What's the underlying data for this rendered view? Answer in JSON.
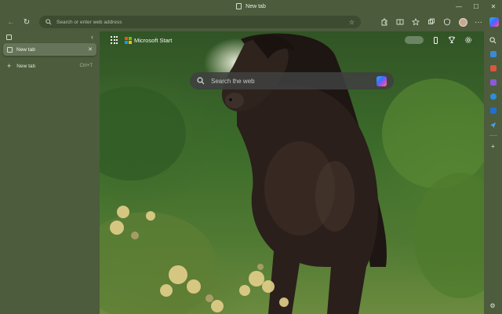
{
  "window": {
    "title": "New tab",
    "controls": {
      "minimize": "—",
      "maximize": "☐",
      "close": "✕"
    }
  },
  "toolbar": {
    "back_icon": "←",
    "refresh_icon": "↻",
    "address_placeholder": "Search or enter web address",
    "favorite_icon": "☆",
    "more_icon": "···"
  },
  "tabpane": {
    "collapse_icon": "‹",
    "tabs": [
      {
        "label": "New tab",
        "close": "✕",
        "active": true
      }
    ],
    "new_tab": {
      "plus": "+",
      "label": "New tab",
      "shortcut": "Ctrl+T"
    }
  },
  "ntp": {
    "brand": "Microsoft Start",
    "search_placeholder": "Search the web",
    "background_description": "dark horse in green field with yellow wildflowers"
  },
  "sidebar": {
    "items": [
      "search-icon",
      "shopping-icon",
      "tools-icon",
      "games-icon",
      "outlook-icon",
      "send-icon"
    ],
    "add": "+",
    "settings": "⚙"
  },
  "colors": {
    "chrome": "#4b5b3c",
    "address_bg": "#3d4b31",
    "active_tab": "#66755a",
    "searchbox": "#404040"
  }
}
